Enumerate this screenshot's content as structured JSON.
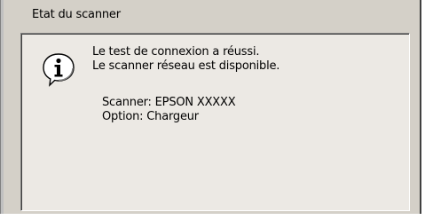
{
  "group": {
    "title": "Etat du scanner"
  },
  "status": {
    "icon": "info-icon",
    "line1": "Le test de connexion a réussi.",
    "line2": "Le scanner réseau est disponible.",
    "scanner": "Scanner: EPSON XXXXX",
    "option": "Option: Chargeur"
  }
}
